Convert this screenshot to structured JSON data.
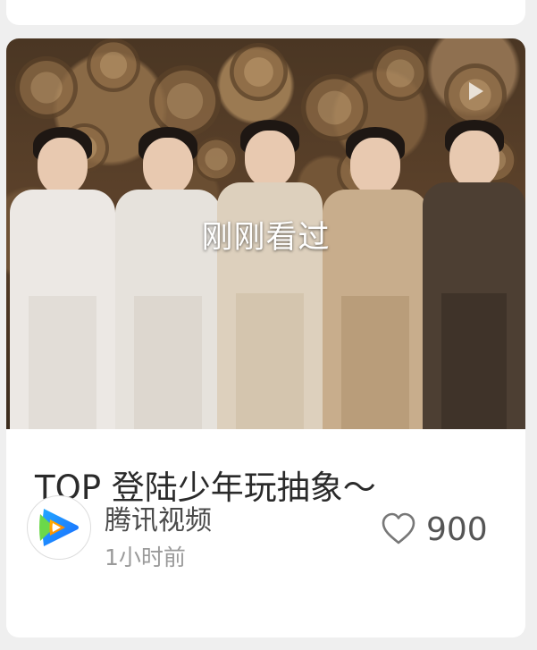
{
  "video": {
    "overlay_label": "刚刚看过",
    "title": "TOP 登陆少年玩抽象～"
  },
  "source": {
    "name": "腾讯视频",
    "time": "1小时前",
    "logo_icon": "tencent-video-logo"
  },
  "stats": {
    "likes": "900",
    "like_icon": "heart-outline-icon"
  }
}
